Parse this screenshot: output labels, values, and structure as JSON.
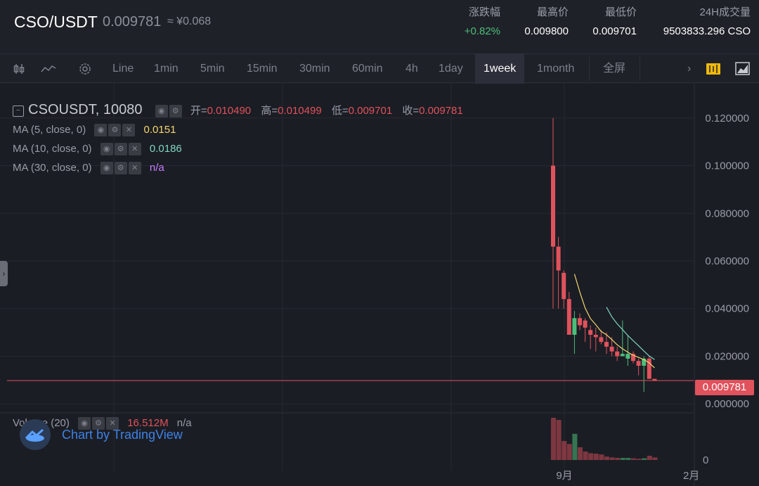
{
  "header": {
    "pair": "CSO/USDT",
    "price": "0.009781",
    "approx": "≈ ¥0.068",
    "stats": [
      {
        "label": "涨跌幅",
        "value": "+0.82%"
      },
      {
        "label": "最高价",
        "value": "0.009800"
      },
      {
        "label": "最低价",
        "value": "0.009701"
      },
      {
        "label": "24H成交量",
        "value": "9503833.296 CSO"
      }
    ]
  },
  "toolbar": {
    "items": [
      "Line",
      "1min",
      "5min",
      "15min",
      "30min",
      "60min",
      "4h",
      "1day",
      "1week",
      "1month",
      "全屏"
    ],
    "active": "1week"
  },
  "legend": {
    "symbol": "CSOUSDT, 10080",
    "open_label": "开=",
    "open": "0.010490",
    "high_label": "高=",
    "high": "0.010499",
    "low_label": "低=",
    "low": "0.009701",
    "close_label": "收=",
    "close": "0.009781",
    "ma": [
      {
        "label": "MA (5, close, 0)",
        "value": "0.0151",
        "color": "#f5d76e"
      },
      {
        "label": "MA (10, close, 0)",
        "value": "0.0186",
        "color": "#7fd6c2"
      },
      {
        "label": "MA (30, close, 0)",
        "value": "n/a",
        "color": "#c77dff"
      }
    ],
    "volume_label": "Volume (20)",
    "volume_value": "16.512M",
    "volume_ma": "n/a"
  },
  "branding": "Chart by TradingView",
  "last_price_tag": "0.009781",
  "x_labels": [
    "9月",
    "2月"
  ],
  "chart_data": {
    "type": "candlestick",
    "y_ticks": [
      "0.120000",
      "0.100000",
      "0.080000",
      "0.060000",
      "0.040000",
      "0.020000",
      "0.000000"
    ],
    "ylim": [
      -0.002,
      0.122
    ],
    "volume_tick": "0",
    "candles": [
      {
        "o": 0.1,
        "h": 0.12,
        "l": 0.04,
        "c": 0.066
      },
      {
        "o": 0.066,
        "h": 0.07,
        "l": 0.04,
        "c": 0.056
      },
      {
        "o": 0.055,
        "h": 0.056,
        "l": 0.04,
        "c": 0.044
      },
      {
        "o": 0.044,
        "h": 0.047,
        "l": 0.029,
        "c": 0.029
      },
      {
        "o": 0.029,
        "h": 0.039,
        "l": 0.021,
        "c": 0.036
      },
      {
        "o": 0.036,
        "h": 0.038,
        "l": 0.031,
        "c": 0.033
      },
      {
        "o": 0.035,
        "h": 0.036,
        "l": 0.026,
        "c": 0.032
      },
      {
        "o": 0.031,
        "h": 0.033,
        "l": 0.023,
        "c": 0.029
      },
      {
        "o": 0.029,
        "h": 0.032,
        "l": 0.022,
        "c": 0.028
      },
      {
        "o": 0.028,
        "h": 0.031,
        "l": 0.025,
        "c": 0.026
      },
      {
        "o": 0.026,
        "h": 0.03,
        "l": 0.021,
        "c": 0.024
      },
      {
        "o": 0.024,
        "h": 0.028,
        "l": 0.02,
        "c": 0.022
      },
      {
        "o": 0.022,
        "h": 0.024,
        "l": 0.018,
        "c": 0.02
      },
      {
        "o": 0.02,
        "h": 0.035,
        "l": 0.02,
        "c": 0.021
      },
      {
        "o": 0.019,
        "h": 0.029,
        "l": 0.016,
        "c": 0.021
      },
      {
        "o": 0.021,
        "h": 0.022,
        "l": 0.017,
        "c": 0.018
      },
      {
        "o": 0.018,
        "h": 0.019,
        "l": 0.012,
        "c": 0.016
      },
      {
        "o": 0.016,
        "h": 0.02,
        "l": 0.005,
        "c": 0.019
      },
      {
        "o": 0.019,
        "h": 0.02,
        "l": 0.011,
        "c": 0.0105
      },
      {
        "o": 0.01049,
        "h": 0.010499,
        "l": 0.009701,
        "c": 0.009781
      }
    ],
    "volumes": [
      1.0,
      0.95,
      0.45,
      0.38,
      0.62,
      0.3,
      0.2,
      0.16,
      0.15,
      0.13,
      0.08,
      0.06,
      0.05,
      0.05,
      0.05,
      0.04,
      0.03,
      0.04,
      0.1,
      0.06
    ],
    "ma5": [
      0.0545,
      0.047,
      0.0402,
      0.0358,
      0.0332,
      0.0304,
      0.029,
      0.027,
      0.0248,
      0.0231,
      0.0217,
      0.0204,
      0.0195,
      0.0186,
      0.0172,
      0.0151
    ],
    "ma10": [
      0.0406,
      0.0365,
      0.0336,
      0.0312,
      0.0287,
      0.0265,
      0.0244,
      0.0222,
      0.0201,
      0.0186
    ]
  },
  "colors": {
    "up": "#4bbe7a",
    "down": "#e0525c",
    "ma5": "#f5d76e",
    "ma10": "#7fd6c2",
    "ma30": "#c77dff"
  }
}
